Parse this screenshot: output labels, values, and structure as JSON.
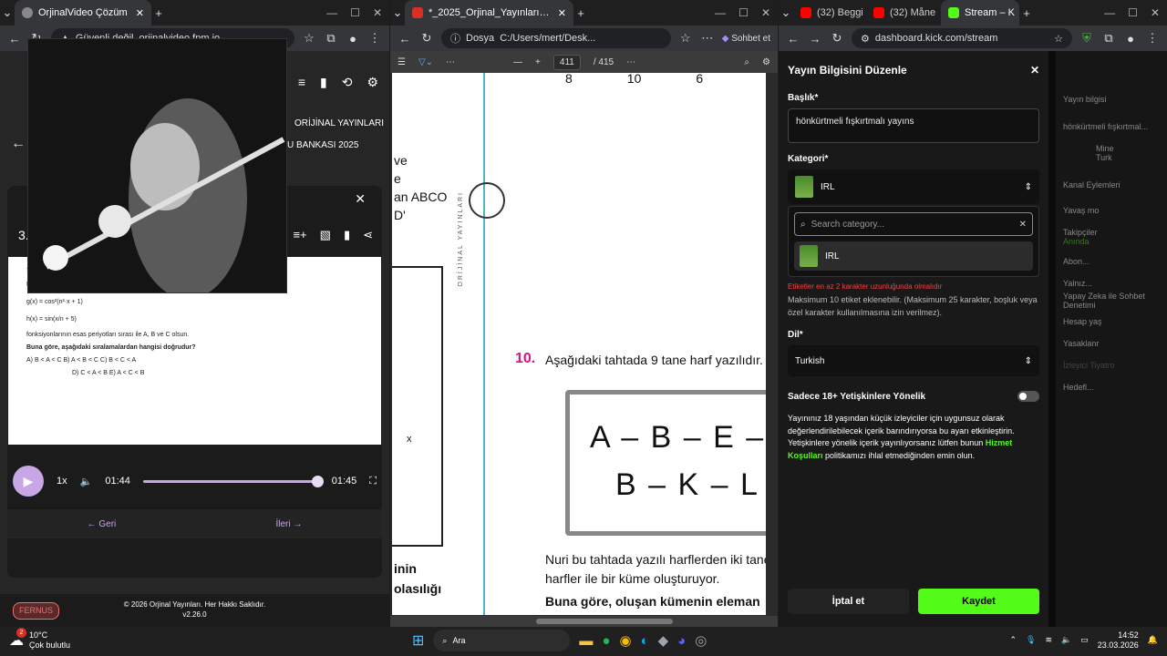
{
  "w1": {
    "tab_title": "OrjinalVideo Çözüm",
    "url_state": "Güvenli değil",
    "url": "orjinalvideo.fpm.io",
    "brand_tag": "ORİJİNAL YAYINLARI",
    "book_tag": "U BANKASI 2025",
    "question_number": "3.",
    "question_lines": [
      "π < n olmak üzere",
      "f(x) = tan²(n·x + 2)",
      "g(x) = cos²(n²·x + 1)",
      "h(x) = sin(x/n + 5)",
      "fonksiyonlarının esas periyotları sırası ile A, B ve C olsun.",
      "Buna göre, aşağıdaki sıralamalardan hangisi doğrudur?",
      "A) B < A < C      B) A < B < C      C) B < C < A",
      "D) C < A < B      E) A < C < B"
    ],
    "speed": "1x",
    "time_current": "01:44",
    "time_total": "01:45",
    "progress": 0.99,
    "prev_label": "Geri",
    "next_label": "İleri",
    "footer_brand": "FERNUS",
    "footer_copy": "© 2026 Orjinal Yayınları. Her Hakkı Saklıdır.",
    "footer_version": "v2.26.0"
  },
  "w2": {
    "tab_title": "*_2025_Orjinal_Yayınları_AYT_Mat...",
    "url_label": "Dosya",
    "url": "C:/Users/mert/Desk...",
    "copilot": "Sohbet et",
    "page_current": "411",
    "page_total": "/ 415",
    "top_numbers": [
      "8",
      "10",
      "6"
    ],
    "left_fragments": [
      "ve",
      "e",
      "an ABCO",
      "D'"
    ],
    "side_text": "ORİJİNAL YAYINLARI",
    "q_num": "10.",
    "q_text": "Aşağıdaki tahtada 9 tane harf yazılıdır.",
    "board_line1": "A – B – E – K",
    "board_line2": "B – K – L –",
    "body1": "Nuri bu tahtada yazılı harflerden iki tane",
    "body2": "harfler ile bir küme oluşturuyor.",
    "body3": "Buna göre, oluşan kümenin eleman",
    "left_bottom1": "inin",
    "left_bottom2": "olasılığı",
    "x_label": "x"
  },
  "w3": {
    "tabs": [
      "(32) Beggi",
      "(32) Måne",
      "Stream – K"
    ],
    "url": "dashboard.kick.com/stream",
    "modal_title": "Yayın Bilgisini Düzenle",
    "title_label": "Başlık*",
    "title_value": "hönkürtmeli fışkırtmalı yayıns",
    "category_label": "Kategori*",
    "category_value": "IRL",
    "search_placeholder": "Search category...",
    "option_irl": "IRL",
    "tags_warning": "Etiketler en az 2 karakter uzunluğunda olmalıdır",
    "tags_note": "Maksimum 10 etiket eklenebilir. (Maksimum 25 karakter, boşluk veya özel karakter kullanılmasına izin verilmez).",
    "lang_label": "Dil*",
    "lang_value": "Turkish",
    "adult_label": "Sadece 18+ Yetişkinlere Yönelik",
    "adult_text1": "Yayınınız 18 yaşından küçük izleyiciler için uygunsuz olarak değerlendirilebilecek içerik barındırıyorsa bu ayarı etkinleştirin. Yetişkinlere yönelik içerik yayınlıyorsanız lütfen bunun ",
    "adult_link": "Hizmet Koşulları",
    "adult_text2": " politikamızı ihlal etmediğinden emin olun.",
    "cancel": "İptal et",
    "save": "Kaydet",
    "bg_items": [
      "Yayın bilgisi",
      "hönkürtmeli fışkırtmal...",
      "Mine",
      "Turk",
      "Kanal Eylemleri",
      "Yavaş mo",
      "Takipçiler",
      "Anında",
      "Abon...",
      "Yalnız...",
      "Yapay Zeka ile Sohbet Denetimi",
      "Hesap yaş",
      "Yasaklanr",
      "İzleyici Tiyatro",
      "Hedefl..."
    ]
  },
  "taskbar": {
    "weather_temp": "10°C",
    "weather_desc": "Çok bulutlu",
    "search": "Ara",
    "time": "14:52",
    "date": "23.03.2026",
    "badge": "2"
  },
  "colors": {
    "kick_green": "#53fc18",
    "purple": "#c9a7e6",
    "magenta": "#d0187f"
  }
}
